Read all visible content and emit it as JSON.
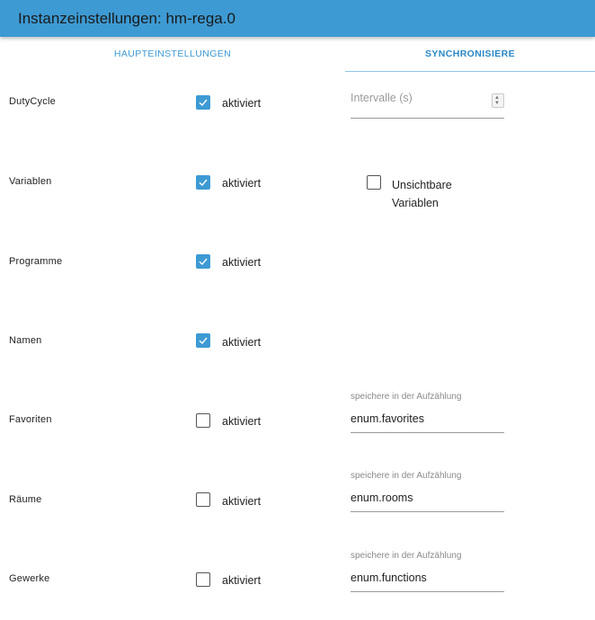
{
  "window": {
    "title": "Instanzeinstellungen: hm-rega.0"
  },
  "tabs": [
    {
      "label": "HAUPTEINSTELLUNGEN"
    },
    {
      "label": "SYNCHRONISIERE"
    }
  ],
  "rows": [
    {
      "label": "DutyCycle",
      "checkbox_text": "aktiviert",
      "checked": true
    },
    {
      "label": "Variablen",
      "checkbox_text": "aktiviert",
      "checked": true
    },
    {
      "label": "Programme",
      "checkbox_text": "aktiviert",
      "checked": true
    },
    {
      "label": "Namen",
      "checkbox_text": "aktiviert",
      "checked": true
    },
    {
      "label": "Favoriten",
      "checkbox_text": "aktiviert",
      "checked": false
    },
    {
      "label": "Räume",
      "checkbox_text": "aktiviert",
      "checked": false
    },
    {
      "label": "Gewerke",
      "checkbox_text": "aktiviert",
      "checked": false
    }
  ],
  "interval": {
    "placeholder": "Intervalle (s)"
  },
  "invisible_variables": {
    "label": "Unsichtbare Variablen",
    "checked": false
  },
  "enum_fields": [
    {
      "caption": "speichere in der Aufzählung",
      "value": "enum.favorites"
    },
    {
      "caption": "speichere in der Aufzählung",
      "value": "enum.rooms"
    },
    {
      "caption": "speichere in der Aufzählung",
      "value": "enum.functions"
    }
  ],
  "colors": {
    "accent": "#3d9ad3",
    "titlebar": "#3d9ad3"
  },
  "icons": {
    "check": "check-icon",
    "spinner": "spinner-arrows-icon"
  }
}
